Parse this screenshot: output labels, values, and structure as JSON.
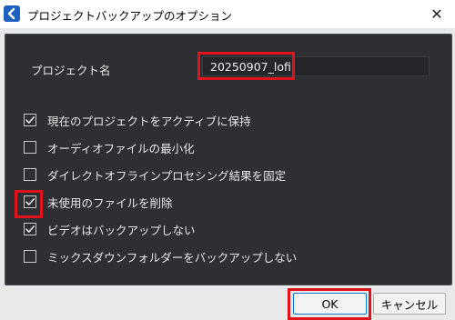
{
  "window": {
    "title": "プロジェクトバックアップのオプション",
    "icon": "app-logo-icon",
    "close_glyph": "✕"
  },
  "project_name": {
    "label": "プロジェクト名",
    "value": "20250907_lofi"
  },
  "options": [
    {
      "label": "現在のプロジェクトをアクティブに保持",
      "checked": true
    },
    {
      "label": "オーディオファイルの最小化",
      "checked": false
    },
    {
      "label": "ダイレクトオフラインプロセシング結果を固定",
      "checked": false
    },
    {
      "label": "未使用のファイルを削除",
      "checked": true
    },
    {
      "label": "ビデオはバックアップしない",
      "checked": true
    },
    {
      "label": "ミックスダウンフォルダーをバックアップしない",
      "checked": false
    }
  ],
  "buttons": {
    "ok": "OK",
    "cancel": "キャンセル"
  },
  "colors": {
    "panel_bg": "#2d2f33",
    "highlight": "#e0121b",
    "accent": "#0078d7"
  }
}
